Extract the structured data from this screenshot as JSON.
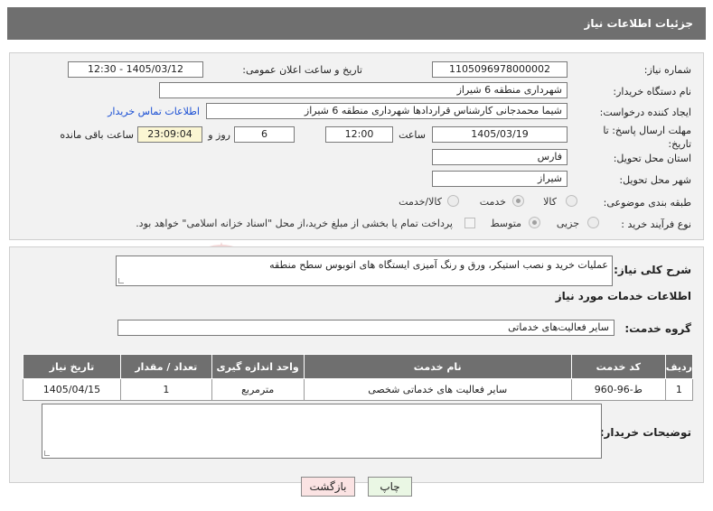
{
  "header": {
    "title": "جزئیات اطلاعات نیاز"
  },
  "form": {
    "need_number": {
      "label": "شماره نیاز:",
      "value": "1105096978000002"
    },
    "announce_datetime": {
      "label": "تاریخ و ساعت اعلان عمومی:",
      "value": "1405/03/12 - 12:30"
    },
    "buyer_org": {
      "label": "نام دستگاه خریدار:",
      "value": "شهرداری منطقه 6 شیراز"
    },
    "creator": {
      "label": "ایجاد کننده درخواست:",
      "value": "شیما محمدجانی کارشناس قراردادها شهرداری منطقه 6 شیراز"
    },
    "contact_link": "اطلاعات تماس خریدار",
    "deadline": {
      "label": "مهلت ارسال پاسخ: تا تاریخ:",
      "date": "1405/03/19",
      "time_label": "ساعت",
      "time": "12:00",
      "days": "6",
      "days_label": "روز و",
      "remaining": "23:09:04",
      "remaining_label": "ساعت باقی مانده"
    },
    "province": {
      "label": "استان محل تحویل:",
      "value": "فارس"
    },
    "city": {
      "label": "شهر محل تحویل:",
      "value": "شیراز"
    },
    "category": {
      "label": "طبقه بندی موضوعی:",
      "options": [
        "کالا",
        "خدمت",
        "کالا/خدمت"
      ],
      "selected": "خدمت"
    },
    "process_type": {
      "label": "نوع فرآیند خرید :",
      "options": [
        "جزیی",
        "متوسط"
      ],
      "selected": "متوسط",
      "payment_note": "پرداخت تمام یا بخشی از مبلغ خرید،از محل \"اسناد خزانه اسلامی\" خواهد بود."
    }
  },
  "description": {
    "label": "شرح کلی نیاز:",
    "value": "عملیات خرید و نصب استیکر، ورق و رنگ آمیزی ایستگاه های اتوبوس سطح منطقه"
  },
  "services": {
    "title": "اطلاعات خدمات مورد نیاز",
    "group_label": "گروه خدمت:",
    "group_value": "سایر فعالیت‌های خدماتی",
    "columns": [
      "ردیف",
      "کد خدمت",
      "نام خدمت",
      "واحد اندازه گیری",
      "تعداد / مقدار",
      "تاریخ نیاز"
    ],
    "rows": [
      [
        "1",
        "ط-96-960",
        "سایر فعالیت های خدماتی شخصی",
        "مترمربع",
        "1",
        "1405/04/15"
      ]
    ]
  },
  "buyer_notes": {
    "label": "توضیحات خریدار:",
    "value": ""
  },
  "buttons": {
    "print": "چاپ",
    "back": "بازگشت"
  },
  "watermark": {
    "text": "AriaTender.net"
  },
  "colors": {
    "header_bg": "#6f6f6f",
    "panel_bg": "#f2f2f2",
    "link": "#1a4fd4",
    "print_btn": "#eaf7e4",
    "back_btn": "#fbe3e3"
  }
}
